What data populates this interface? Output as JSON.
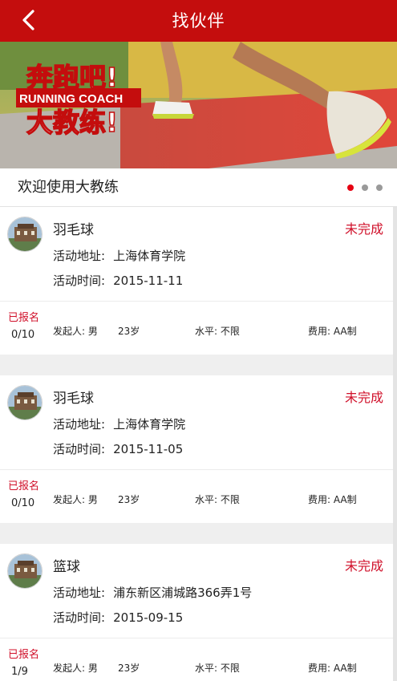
{
  "header": {
    "title": "找伙伴",
    "back_icon": "chevron-left-icon",
    "color": "#c40d0d"
  },
  "banner": {
    "line1": "奔跑吧!",
    "line2": "RUNNING COACH",
    "line3": "大教练!"
  },
  "promo": {
    "text": "欢迎使用大教练",
    "dots": 3,
    "active_dot": 1
  },
  "labels": {
    "address": "活动地址:",
    "time": "活动时间:",
    "signed": "已报名",
    "starter": "发起人:",
    "level": "水平:",
    "fee": "费用:"
  },
  "activities": [
    {
      "sport": "羽毛球",
      "status": "未完成",
      "address": "上海体育学院",
      "time": "2015-11-11",
      "count": "0/10",
      "gender": "男",
      "age": "23岁",
      "level": "不限",
      "fee": "AA制"
    },
    {
      "sport": "羽毛球",
      "status": "未完成",
      "address": "上海体育学院",
      "time": "2015-11-05",
      "count": "0/10",
      "gender": "男",
      "age": "23岁",
      "level": "不限",
      "fee": "AA制"
    },
    {
      "sport": "篮球",
      "status": "未完成",
      "address": "浦东新区浦城路366弄1号",
      "time": "2015-09-15",
      "count": "1/9",
      "gender": "男",
      "age": "23岁",
      "level": "不限",
      "fee": "AA制"
    }
  ],
  "colors": {
    "accent": "#c40d0d",
    "status_red": "#d0102a",
    "background": "#efefef"
  }
}
